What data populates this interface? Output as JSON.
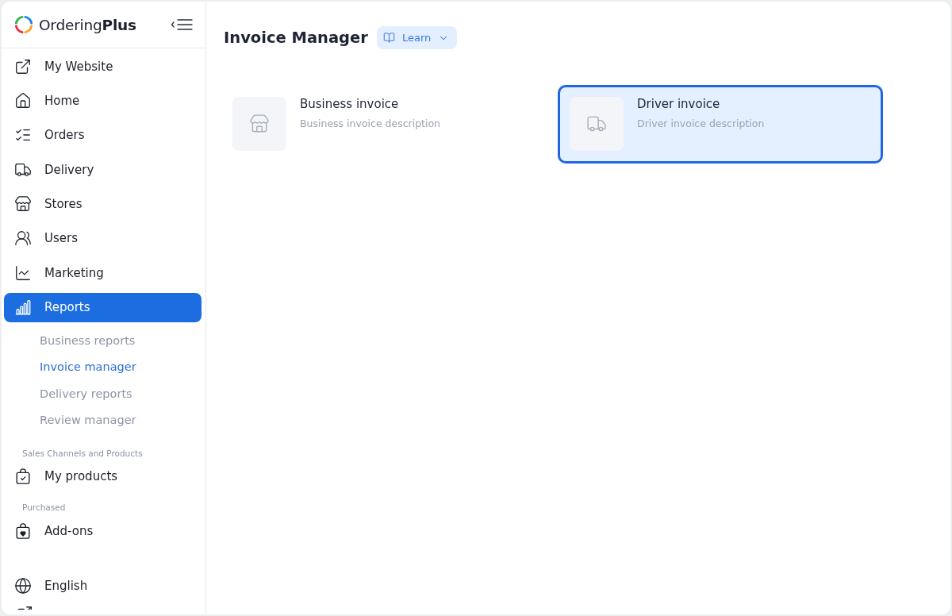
{
  "sidebar": {
    "logo": {
      "text": "Ordering**Plus**"
    },
    "groups": [
      {
        "items": [
          {
            "label": "My Website",
            "selected": false
          },
          {
            "label": "Home",
            "selected": false
          },
          {
            "label": "Orders",
            "selected": false
          },
          {
            "label": "Delivery",
            "selected": false
          },
          {
            "label": "Stores",
            "selected": false
          },
          {
            "label": "Users",
            "selected": false
          },
          {
            "label": "Marketing",
            "selected": false
          },
          {
            "label": "Reports",
            "selected": true,
            "children": [
              {
                "label": "Business reports",
                "selected": false
              },
              {
                "label": "Invoice manager",
                "selected": true
              },
              {
                "label": "Delivery reports",
                "selected": false
              },
              {
                "label": "Review manager",
                "selected": false
              }
            ]
          }
        ]
      },
      {
        "heading": "Sales Channels and Products",
        "items": [
          {
            "label": "My products",
            "selected": false
          }
        ]
      },
      {
        "heading": "Purchased",
        "items": [
          {
            "label": "Add-ons",
            "selected": false
          }
        ]
      }
    ],
    "footer": [
      {
        "label": "English"
      }
    ]
  },
  "main": {
    "title": "Invoice Manager",
    "learn_button": {
      "label": "Learn"
    },
    "cards": [
      {
        "title": "Business invoice",
        "description": "Business invoice description",
        "selected": false
      },
      {
        "title": "Driver invoice",
        "description": "Driver invoice description",
        "selected": true
      }
    ]
  }
}
